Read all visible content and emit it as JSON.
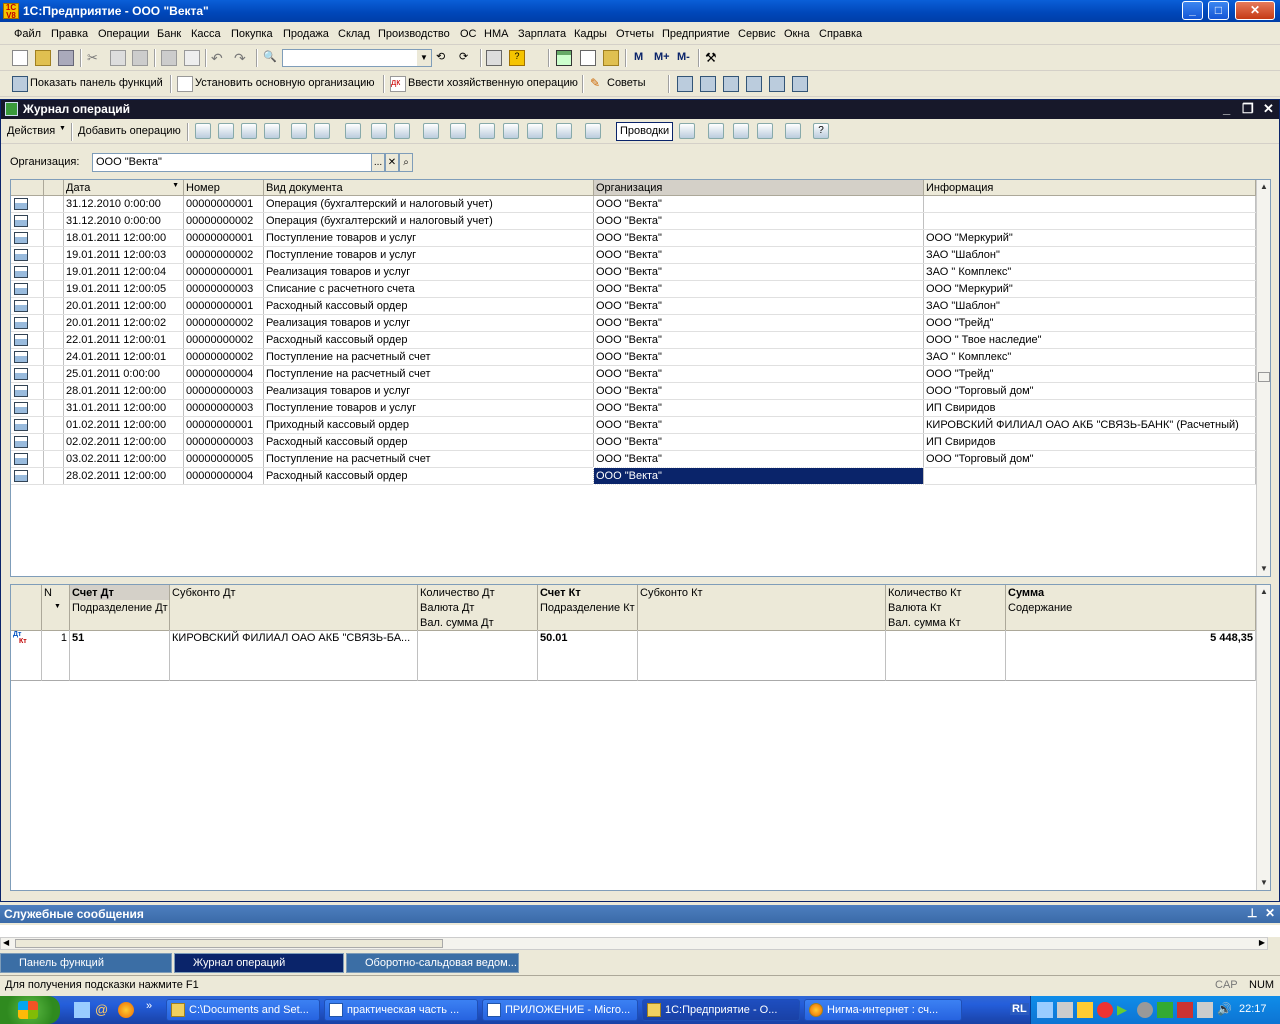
{
  "app": {
    "title": "1С:Предприятие - ООО \"Векта\""
  },
  "menu": [
    "Файл",
    "Правка",
    "Операции",
    "Банк",
    "Касса",
    "Покупка",
    "Продажа",
    "Склад",
    "Производство",
    "ОС",
    "НМА",
    "Зарплата",
    "Кадры",
    "Отчеты",
    "Предприятие",
    "Сервис",
    "Окна",
    "Справка"
  ],
  "toolbar2": {
    "show_panel": "Показать панель функций",
    "set_org": "Установить основную организацию",
    "enter_op": "Ввести хозяйственную операцию",
    "advice": "Советы"
  },
  "toolbar1": {
    "m": "M",
    "mplus": "M+",
    "mminus": "M-"
  },
  "doc": {
    "title": "Журнал операций",
    "actions": "Действия",
    "add_op": "Добавить операцию",
    "postings": "Проводки",
    "org_label": "Организация:",
    "org_value": "ООО \"Векта\""
  },
  "journal": {
    "headers": [
      "Дата",
      "Номер",
      "Вид документа",
      "Организация",
      "Информация"
    ],
    "rows": [
      [
        "31.12.2010 0:00:00",
        "00000000001",
        "Операция (бухгалтерский и налоговый учет)",
        "ООО \"Векта\"",
        ""
      ],
      [
        "31.12.2010 0:00:00",
        "00000000002",
        "Операция (бухгалтерский и налоговый учет)",
        "ООО \"Векта\"",
        ""
      ],
      [
        "18.01.2011 12:00:00",
        "00000000001",
        "Поступление товаров и услуг",
        "ООО \"Векта\"",
        "ООО \"Меркурий\""
      ],
      [
        "19.01.2011 12:00:03",
        "00000000002",
        "Поступление товаров и услуг",
        "ООО \"Векта\"",
        "ЗАО \"Шаблон\""
      ],
      [
        "19.01.2011 12:00:04",
        "00000000001",
        "Реализация товаров и услуг",
        "ООО \"Векта\"",
        "ЗАО \" Комплекс\""
      ],
      [
        "19.01.2011 12:00:05",
        "00000000003",
        "Списание с расчетного счета",
        "ООО \"Векта\"",
        "ООО \"Меркурий\""
      ],
      [
        "20.01.2011 12:00:00",
        "00000000001",
        "Расходный кассовый ордер",
        "ООО \"Векта\"",
        "ЗАО \"Шаблон\""
      ],
      [
        "20.01.2011 12:00:02",
        "00000000002",
        "Реализация товаров и услуг",
        "ООО \"Векта\"",
        "ООО \"Трейд\""
      ],
      [
        "22.01.2011 12:00:01",
        "00000000002",
        "Расходный кассовый ордер",
        "ООО \"Векта\"",
        "ООО \" Твое наследие\""
      ],
      [
        "24.01.2011 12:00:01",
        "00000000002",
        "Поступление на расчетный счет",
        "ООО \"Векта\"",
        "ЗАО \" Комплекс\""
      ],
      [
        "25.01.2011 0:00:00",
        "00000000004",
        "Поступление на расчетный счет",
        "ООО \"Векта\"",
        "ООО \"Трейд\""
      ],
      [
        "28.01.2011 12:00:00",
        "00000000003",
        "Реализация товаров и услуг",
        "ООО \"Векта\"",
        "ООО \"Торговый дом\""
      ],
      [
        "31.01.2011 12:00:00",
        "00000000003",
        "Поступление товаров и услуг",
        "ООО \"Векта\"",
        "ИП Свиридов"
      ],
      [
        "01.02.2011 12:00:00",
        "00000000001",
        "Приходный кассовый ордер",
        "ООО \"Векта\"",
        "КИРОВСКИЙ ФИЛИАЛ ОАО АКБ \"СВЯЗЬ-БАНК\" (Расчетный)"
      ],
      [
        "02.02.2011 12:00:00",
        "00000000003",
        "Расходный кассовый ордер",
        "ООО \"Векта\"",
        "ИП Свиридов"
      ],
      [
        "03.02.2011 12:00:00",
        "00000000005",
        "Поступление на расчетный счет",
        "ООО \"Векта\"",
        "ООО \"Торговый дом\""
      ],
      [
        "28.02.2011 12:00:00",
        "00000000004",
        "Расходный кассовый ордер",
        "ООО \"Векта\"",
        ""
      ]
    ]
  },
  "postings": {
    "h1": [
      "N",
      "Счет Дт",
      "Субконто Дт",
      "Количество Дт",
      "Счет Кт",
      "Субконто Кт",
      "Количество Кт",
      "Сумма"
    ],
    "h2": [
      "Подразделение Дт",
      "Валюта Дт",
      "Подразделение Кт",
      "Валюта Кт",
      "Содержание"
    ],
    "h3": [
      "Вал. сумма Дт",
      "Вал. сумма Кт"
    ],
    "row": {
      "n": "1",
      "dt": "51",
      "sub_dt": "КИРОВСКИЙ ФИЛИАЛ ОАО АКБ \"СВЯЗЬ-БА...",
      "kt": "50.01",
      "sum": "5 448,35",
      "icon_dt": "Дт",
      "icon_kt": "Кт"
    }
  },
  "messages": {
    "title": "Служебные сообщения"
  },
  "window_tabs": [
    "Панель функций",
    "Журнал операций",
    "Оборотно-сальдовая ведом..."
  ],
  "status": {
    "hint": "Для получения подсказки нажмите F1",
    "cap": "CAP",
    "num": "NUM"
  },
  "taskbar": {
    "items": [
      "C:\\Documents and Set...",
      "практическая часть ...",
      "ПРИЛОЖЕНИЕ - Micro...",
      "1С:Предприятие - О...",
      "Нигма-интернет : сч..."
    ],
    "lang": "RL",
    "clock": "22:17"
  }
}
